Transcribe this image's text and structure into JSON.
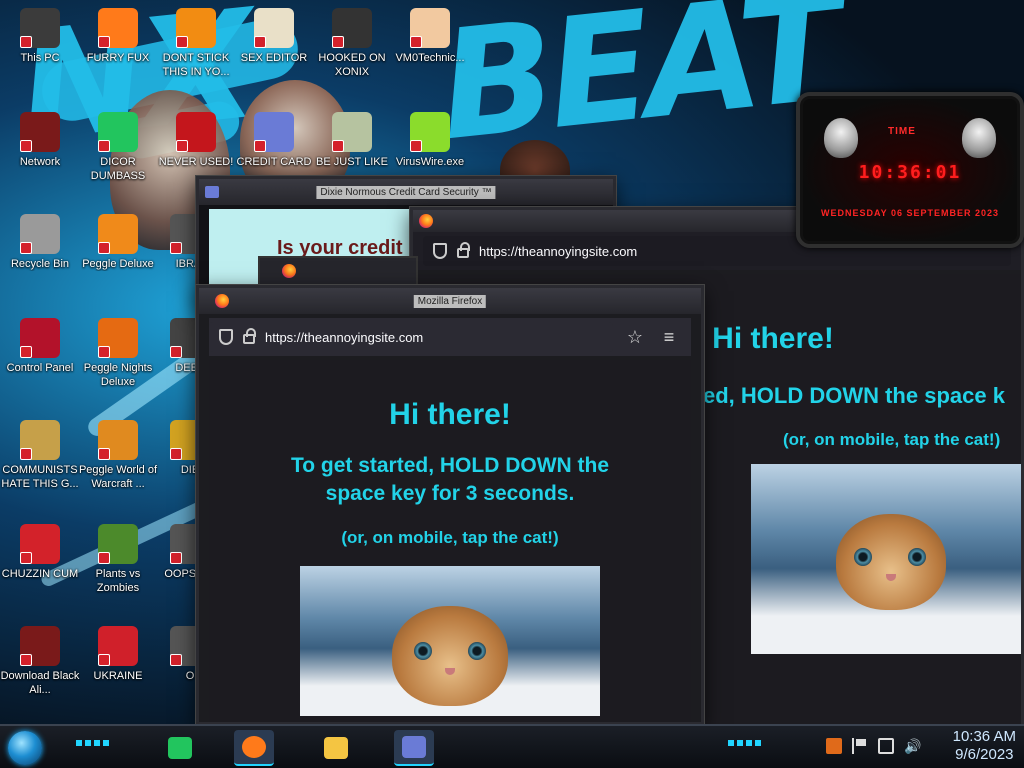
{
  "wallpaper": {
    "text": "BEAT",
    "text2": "NX"
  },
  "desktop_icons": [
    {
      "label": "This PC",
      "icon": "computer-icon",
      "color": "#3b3b3b"
    },
    {
      "label": "FURRY FUX",
      "icon": "firefox-icon",
      "color": "#ff7a1a"
    },
    {
      "label": "DONT STICK THIS IN YO...",
      "icon": "vlc-cone-icon",
      "color": "#f28c12"
    },
    {
      "label": "SEX EDITOR",
      "icon": "hxd-editor-icon",
      "color": "#e9e0c8"
    },
    {
      "label": "HOOKED ON XONIX",
      "icon": "xonix-game-icon",
      "color": "#333333"
    },
    {
      "label": "VM0Technic...",
      "icon": "technician-icon",
      "color": "#f2c9a0"
    },
    {
      "label": "Network",
      "icon": "network-alien-icon",
      "color": "#7a1a1a"
    },
    {
      "label": "DICOR DUMBASS",
      "icon": "chat-app-icon",
      "color": "#22c55e"
    },
    {
      "label": "NEVER USED!",
      "icon": "dev-cpp-icon",
      "color": "#c4161c"
    },
    {
      "label": "CREDIT CARD",
      "icon": "credit-card-icon",
      "color": "#6a7bd6"
    },
    {
      "label": "BE JUST LIKE",
      "icon": "santa-face-icon",
      "color": "#b6c3a0"
    },
    {
      "label": "VirusWire.exe",
      "icon": "lime-icon",
      "color": "#8bdc2c"
    },
    {
      "label": "Recycle Bin",
      "icon": "recycle-bin-icon",
      "color": "#9a9a9a"
    },
    {
      "label": "Peggle Deluxe",
      "icon": "peggle-icon",
      "color": "#f08a1a"
    },
    {
      "label": "IBRAI",
      "icon": "app-icon",
      "color": "#555555"
    },
    {
      "label": "Control Panel",
      "icon": "control-panel-icon",
      "color": "#b3122a"
    },
    {
      "label": "Peggle Nights Deluxe",
      "icon": "peggle-nights-icon",
      "color": "#e56a12"
    },
    {
      "label": "DEEZ",
      "icon": "app-icon",
      "color": "#444444"
    },
    {
      "label": "COMMUNISTS HATE THIS G...",
      "icon": "money-bag-icon",
      "color": "#c6a049"
    },
    {
      "label": "Peggle World of Warcraft ...",
      "icon": "peggle-wow-icon",
      "color": "#e08a1f"
    },
    {
      "label": "DIE",
      "icon": "app-icon",
      "color": "#d3a321"
    },
    {
      "label": "CHUZZIN CUM",
      "icon": "chuzzle-icon",
      "color": "#d3222a"
    },
    {
      "label": "Plants vs Zombies",
      "icon": "pvz-icon",
      "color": "#4c8a2b"
    },
    {
      "label": "OOPS DO",
      "icon": "app-icon",
      "color": "#555555"
    },
    {
      "label": "Download Black Ali...",
      "icon": "alien-download-icon",
      "color": "#7a1a1a"
    },
    {
      "label": "UKRAINE",
      "icon": "radiation-icon",
      "color": "#d0202a"
    },
    {
      "label": "O",
      "icon": "app-icon",
      "color": "#555555"
    }
  ],
  "back_window": {
    "title": "Dixie Normous Credit Card Security ™",
    "page_text": "Is your credit"
  },
  "firefox_window_right": {
    "url": "https://theannoyingsite.com",
    "heading": "Hi there!",
    "line": "ed, HOLD DOWN the space k",
    "mobile": "(or, on mobile, tap the cat!)"
  },
  "firefox_window_front": {
    "title": "Mozilla Firefox",
    "url": "https://theannoyingsite.com",
    "heading": "Hi there!",
    "instructions": "To get started, HOLD DOWN the space key for 3 seconds.",
    "mobile": "(or, on mobile, tap the cat!)"
  },
  "gadget": {
    "label": "TIME",
    "time": "10:36:01",
    "date": "WEDNESDAY 06 SEPTEMBER 2023"
  },
  "taskbar": {
    "apps": [
      {
        "name": "chat-app",
        "icon": "chat-app-icon",
        "color": "#22c55e"
      },
      {
        "name": "firefox",
        "icon": "firefox-icon",
        "color": "#ff7a1a"
      },
      {
        "name": "file-explorer",
        "icon": "folder-icon",
        "color": "#f4c542"
      },
      {
        "name": "credit-card-app",
        "icon": "credit-card-icon",
        "color": "#6a7bd6"
      }
    ],
    "clock_time": "10:36 AM",
    "clock_date": "9/6/2023"
  }
}
